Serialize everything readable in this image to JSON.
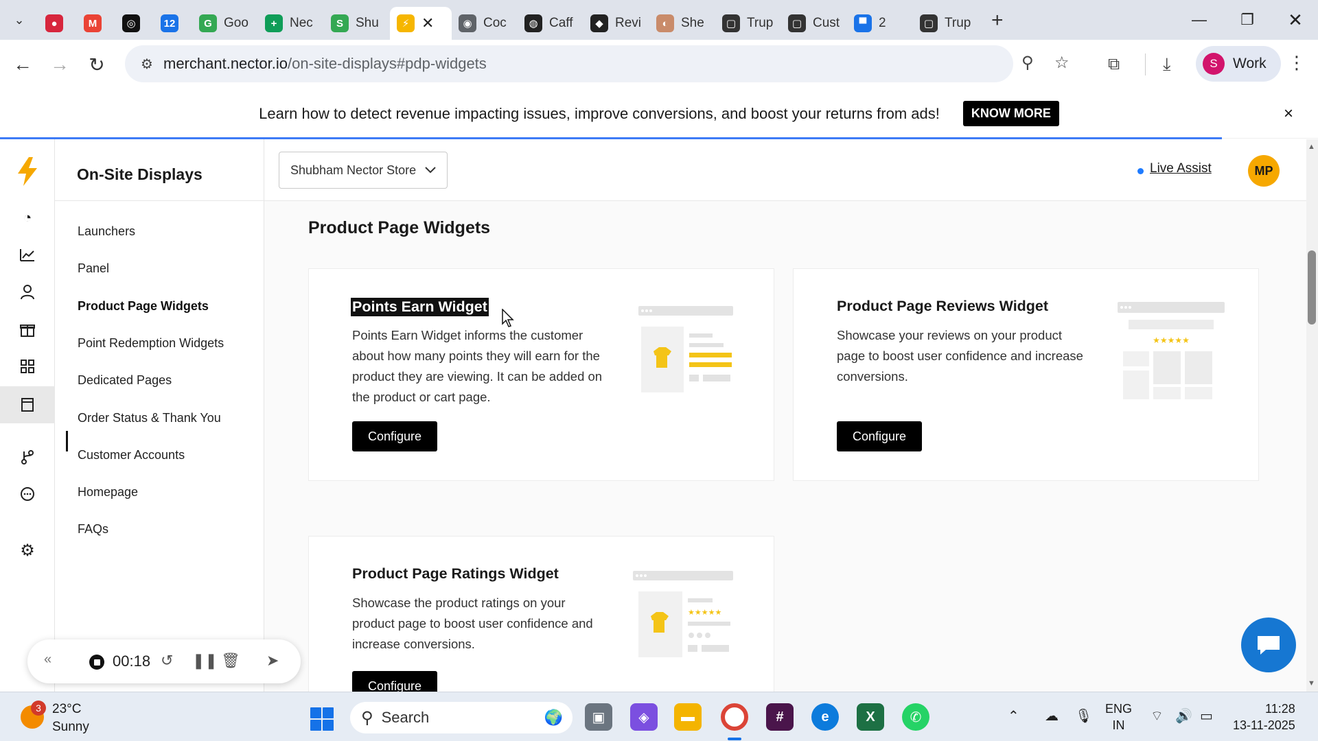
{
  "browser": {
    "tabs": [
      {
        "label": "",
        "color": "#d7263d",
        "glyph": "●"
      },
      {
        "label": "",
        "color": "#ea4335",
        "glyph": "M"
      },
      {
        "label": "",
        "color": "#111111",
        "glyph": "◎"
      },
      {
        "label": "",
        "color": "#1a73e8",
        "glyph": "12"
      },
      {
        "label": "Goo",
        "color": "#34a853",
        "glyph": "G"
      },
      {
        "label": "Nec",
        "color": "#0f9d58",
        "glyph": "+"
      },
      {
        "label": "Shu",
        "color": "#34a853",
        "glyph": "S"
      },
      {
        "label": "",
        "color": "#f6b600",
        "glyph": "⚡",
        "active": true
      },
      {
        "label": "Coc",
        "color": "#5f6368",
        "glyph": "◉"
      },
      {
        "label": "Caff",
        "color": "#222222",
        "glyph": "◍"
      },
      {
        "label": "Revi",
        "color": "#222222",
        "glyph": "◆"
      },
      {
        "label": "She",
        "color": "#c98b6a",
        "glyph": "◐"
      },
      {
        "label": "Trup",
        "color": "#333333",
        "glyph": "▢"
      },
      {
        "label": "Cust",
        "color": "#333333",
        "glyph": "▢"
      },
      {
        "label": "2",
        "color": "#1a73e8",
        "glyph": "▀"
      },
      {
        "label": "Trup",
        "color": "#333333",
        "glyph": "▢"
      }
    ],
    "url_host": "merchant.nector.io",
    "url_path": "/on-site-displays#pdp-widgets",
    "profile_initial": "S",
    "profile_label": "Work"
  },
  "promo": {
    "text": "Learn how to detect revenue impacting issues, improve conversions, and boost your returns from ads!",
    "button": "KNOW MORE",
    "close": "×"
  },
  "rail": {
    "items": [
      "pie-chart-icon",
      "trend-chart-icon",
      "user-icon",
      "gift-icon",
      "grid-icon",
      "page-icon",
      "branch-icon",
      "chat-icon",
      "gear-icon"
    ],
    "active": "page-icon"
  },
  "sidebar": {
    "title": "On-Site Displays",
    "items": [
      {
        "label": "Launchers"
      },
      {
        "label": "Panel"
      },
      {
        "label": "Product Page Widgets",
        "active": true
      },
      {
        "label": "Point Redemption Widgets"
      },
      {
        "label": "Dedicated Pages"
      },
      {
        "label": "Order Status & Thank You"
      },
      {
        "label": "Customer Accounts"
      },
      {
        "label": "Homepage"
      },
      {
        "label": "FAQs"
      }
    ]
  },
  "header": {
    "store": "Shubham Nector Store",
    "live_assist": "Live Assist",
    "avatar": "MP"
  },
  "main": {
    "title": "Product Page Widgets",
    "cards": [
      {
        "title": "Points Earn Widget",
        "description": "Points Earn Widget informs the customer about how many points they will earn for the product they are viewing. It can be added on the product or cart page.",
        "button": "Configure",
        "selected": true
      },
      {
        "title": "Product Page Reviews Widget",
        "description": "Showcase your reviews on your product page to boost user confidence and increase conversions.",
        "button": "Configure"
      },
      {
        "title": "Product Page Ratings Widget",
        "description": "Showcase the product ratings on your product page to boost user confidence and increase conversions.",
        "button": "Configure"
      }
    ]
  },
  "recorder": {
    "time": "00:18"
  },
  "taskbar": {
    "weather_badge": "3",
    "temperature": "23°C",
    "condition": "Sunny",
    "search": "Search",
    "language_1": "ENG",
    "language_2": "IN",
    "time": "11:28",
    "date": "13-11-2025"
  },
  "colors": {
    "accent": "#f6a800",
    "button": "#000000",
    "link_dot": "#1e7bff",
    "chat": "#1677d2"
  }
}
